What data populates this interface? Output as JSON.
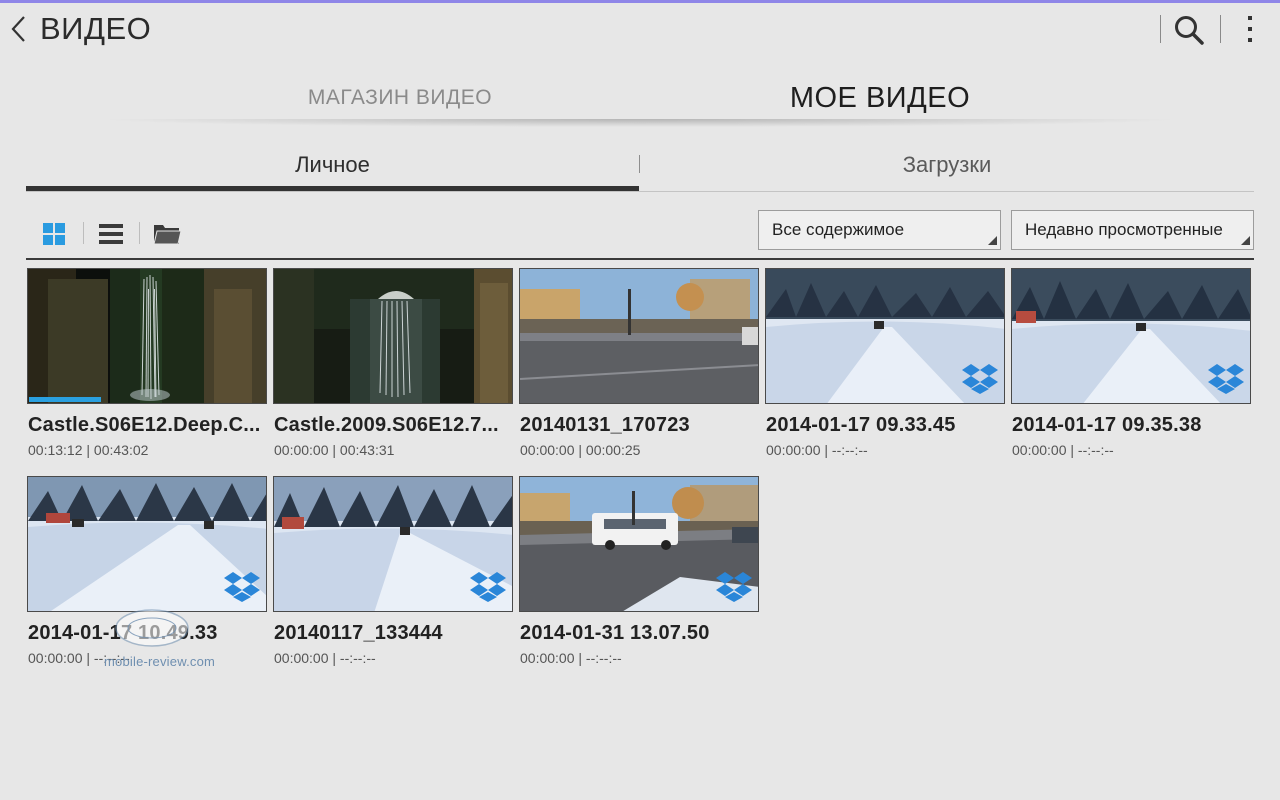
{
  "app": {
    "title": "ВИДЕО"
  },
  "colors": {
    "accent": "#8f86e8",
    "progress": "#2aa0e0",
    "dropbox": "#2a86d8",
    "grid_icon": "#2a9be0"
  },
  "main_tabs": [
    {
      "label": "МАГАЗИН ВИДЕО",
      "selected": false
    },
    {
      "label": "МОЕ ВИДЕО",
      "selected": true
    }
  ],
  "sub_tabs": [
    {
      "label": "Личное",
      "selected": true
    },
    {
      "label": "Загрузки",
      "selected": false
    }
  ],
  "toolbar": {
    "view_icons": [
      "grid-view-icon",
      "list-view-icon",
      "folder-view-icon"
    ],
    "filter_value": "Все содержимое",
    "sort_value": "Недавно просмотренные"
  },
  "videos": [
    {
      "title": "Castle.S06E12.Deep.C...",
      "position": "00:13:12",
      "duration": "00:43:02",
      "watched_fraction": 0.3,
      "dropbox": false
    },
    {
      "title": "Castle.2009.S06E12.7...",
      "position": "00:00:00",
      "duration": "00:43:31",
      "watched_fraction": 0,
      "dropbox": false
    },
    {
      "title": "20140131_170723",
      "position": "00:00:00",
      "duration": "00:00:25",
      "watched_fraction": 0,
      "dropbox": false
    },
    {
      "title": "2014-01-17 09.33.45",
      "position": "00:00:00",
      "duration": "--:--:--",
      "watched_fraction": 0,
      "dropbox": true
    },
    {
      "title": "2014-01-17 09.35.38",
      "position": "00:00:00",
      "duration": "--:--:--",
      "watched_fraction": 0,
      "dropbox": true
    },
    {
      "title": "2014-01-17 10.49.33",
      "position": "00:00:00",
      "duration": "--:--:--",
      "watched_fraction": 0,
      "dropbox": true
    },
    {
      "title": "20140117_133444",
      "position": "00:00:00",
      "duration": "--:--:--",
      "watched_fraction": 0,
      "dropbox": true
    },
    {
      "title": "2014-01-31 13.07.50",
      "position": "00:00:00",
      "duration": "--:--:--",
      "watched_fraction": 0,
      "dropbox": true
    }
  ],
  "watermark": {
    "text": "mobile-review.com"
  }
}
